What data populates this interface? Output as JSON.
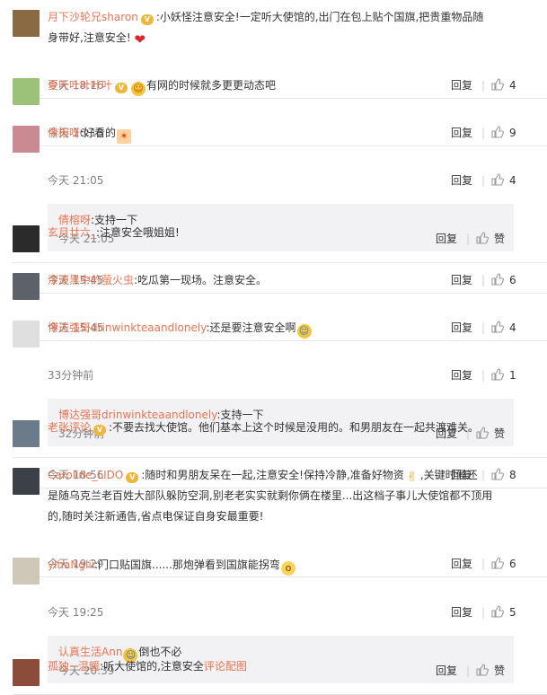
{
  "labels": {
    "reply": "回复",
    "praise": "赞"
  },
  "comments": [
    {
      "user": "月下沙轮兄sharon",
      "badge": true,
      "lines": [
        ":小妖怪注意安全!一定听大使馆的,出门在包上贴个国旗,把贵重物品随",
        "身带好,注意安全!"
      ],
      "end_emoji": "heart-emoji",
      "time": "今天 18:16",
      "likes": "4",
      "avatar_color": "#8a6a42"
    },
    {
      "user": "夏叶叶叶叶叶",
      "badge": true,
      "lines": [
        "有网的时候就多更更动态吧"
      ],
      "start_emoji": "happy-face-emoji",
      "time": "今天 16:13",
      "likes": "9",
      "avatar_color": "#9cc27a"
    },
    {
      "user": "倩榕呀",
      "lines": [
        ":好看的"
      ],
      "end_emoji": "sparkle-emoji",
      "time": "今天 21:05",
      "likes": "4",
      "avatar_color": "#c98a92",
      "reply": {
        "user": "倩榕呀",
        "text": ":支持一下",
        "time": "今天 21:05"
      }
    },
    {
      "user": "玄月廿六_",
      "lines": [
        ":注意安全哦姐姐!"
      ],
      "time": "今天 15:45",
      "likes": "6",
      "avatar_color": "#2b2b2b"
    },
    {
      "user": "漆漆黑中的萤火虫",
      "lines": [
        ":吃瓜第一现场。注意安全。"
      ],
      "time": "今天 15:45",
      "likes": "4",
      "avatar_color": "#5c6268"
    },
    {
      "user": "博达强哥drinwinkteaandlonely",
      "lines": [
        ":还是要注意安全啊"
      ],
      "end_emoji": "sweat-smile-emoji",
      "time": "33分钟前",
      "likes": "1",
      "avatar_color": "#dedede",
      "reply": {
        "user": "博达强哥drinwinkteaandlonely",
        "text": ":支持一下",
        "time": "32分钟前"
      }
    },
    {
      "user": "老张评论",
      "badge": true,
      "lines": [
        ":不要去找大使馆。他们基本上这个时候是没用的。和男朋友在一起共渡难关。"
      ],
      "time": "今天 18:56",
      "likes": "8",
      "avatar_color": "#6b7b8a"
    },
    {
      "user": "Caroline_LIDO",
      "badge": true,
      "lines": [
        ":随时和男朋友呆在一起,注意安全!保持冷静,准备好物资",
        "是随乌克兰老百姓大部队躲防空洞,别老老实实就剩你俩在楼里...出这档子事儿大使馆都不顶用",
        "的,随时关注新通告,省点电保证自身安最重要!"
      ],
      "line0_tail": ",关键时候还",
      "line0_emoji": "thumbs-up-emoji",
      "time": "今天 19:29",
      "likes": "6",
      "avatar_color": "#3c4148"
    },
    {
      "user": "ylhaNglii",
      "lines": [
        ":门口贴国旗......那炮弹看到国旗能拐弯"
      ],
      "end_emoji": "surprised-face-emoji",
      "time": "今天 19:25",
      "likes": "5",
      "avatar_color": "#cfc7b8",
      "reply": {
        "user": "认真生活Ann",
        "text": "倒也不必",
        "start_emoji": "laughing-face-emoji",
        "time": "今天 20:39"
      }
    },
    {
      "user": "孤独~温暖",
      "lines": [
        ":听大使馆的,注意安全"
      ],
      "tail_link": "评论配图",
      "avatar_color": "#8b4d3a"
    }
  ]
}
